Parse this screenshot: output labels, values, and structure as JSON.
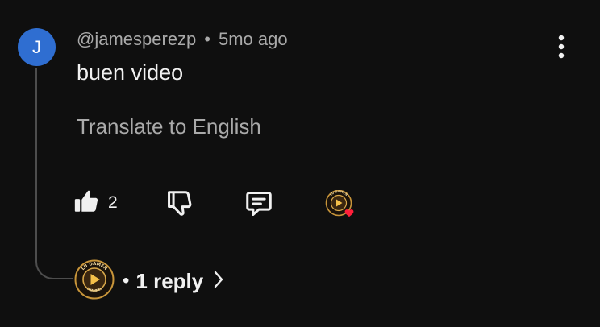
{
  "comment": {
    "avatar_initial": "J",
    "author": "@jamesperezp",
    "separator": "•",
    "time": "5mo ago",
    "text": "buen video",
    "translate_label": "Translate to English"
  },
  "actions": {
    "like_count": "2"
  },
  "replies": {
    "separator": "•",
    "label": "1 reply"
  },
  "channel_logo": {
    "top_text": "LU DAMEN",
    "bottom_text": "CHANNEL"
  },
  "colors": {
    "background": "#0f0f0f",
    "avatar": "#2f6ed1",
    "heart": "#ff1f3a",
    "logo_ring": "#c8953a"
  }
}
